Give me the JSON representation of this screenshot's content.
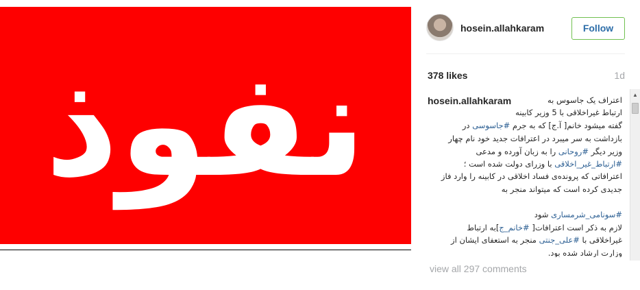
{
  "post": {
    "image_text": "نفوذ",
    "image_color": "#fe0000"
  },
  "header": {
    "username": "hosein.allahkaram",
    "follow_label": "Follow",
    "follow_border_color": "#70c050",
    "follow_text_color": "#2c6da8"
  },
  "stats": {
    "likes": "378 likes",
    "time": "1d"
  },
  "caption": {
    "username": "hosein.allahkaram",
    "lines": [
      {
        "pre": "اعتراف یک جاسوس به",
        "tag": "",
        "post": ""
      },
      {
        "pre": "ارتباط غیراخلاقی با 5 وزیر کابینه",
        "tag": "",
        "post": ""
      },
      {
        "pre": "گفته میشود خانم[ آ.ج] که به جرم ",
        "tag": "#جاسوسی",
        "post": " در"
      },
      {
        "pre": "بازداشت به سر میبرد در اعترافات جدید خود نام چهار",
        "tag": "",
        "post": ""
      },
      {
        "pre": "وزیر دیگر ",
        "tag": "#روحانی",
        "post": " را به زبان آورده و مدعی"
      },
      {
        "pre": "",
        "tag": "#ارتباط_غیر_اخلاقی",
        "post": " با وزرای دولت شده است ؛"
      },
      {
        "pre": "اعترافاتی که پرونده‌ی فساد اخلاقی در کابینه را وارد فاز",
        "tag": "",
        "post": ""
      },
      {
        "pre": "جدیدی کرده است که میتواند منجر به",
        "tag": "",
        "post": ""
      },
      {
        "pre": "",
        "tag": "",
        "post": ""
      },
      {
        "pre": "",
        "tag": "#سونامی_شرمساری",
        "post": " شود"
      },
      {
        "pre": "لازم به ذکر است اعترافات[ ",
        "tag": "#خانم_ج",
        "post": "]به ارتباط"
      },
      {
        "pre": "غیراخلاقی با ",
        "tag": "#علی_جنتی",
        "post": " منجر به استعفای ایشان از"
      },
      {
        "pre": "وزارت ارشاد شده بود.",
        "tag": "",
        "post": ""
      }
    ]
  },
  "comments": {
    "view_all": "view all 297 comments"
  },
  "icons": {
    "scroll_up": "scroll-up-arrow-icon"
  }
}
